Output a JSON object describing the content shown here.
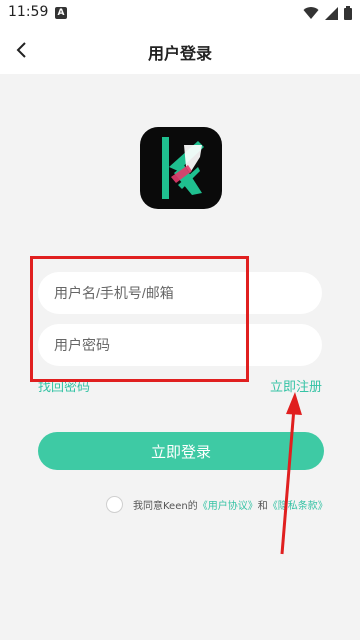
{
  "status_bar": {
    "time": "11:59",
    "badge": "A",
    "icons": [
      "wifi-icon",
      "signal-icon",
      "battery-icon"
    ]
  },
  "header": {
    "title": "用户登录",
    "back_icon": "chevron-left-icon"
  },
  "logo": {
    "name": "keen-app-logo"
  },
  "form": {
    "username_placeholder": "用户名/手机号/邮箱",
    "password_placeholder": "用户密码",
    "forgot_password": "找回密码",
    "register": "立即注册",
    "login_button": "立即登录"
  },
  "agreement": {
    "prefix": "我同意Keen的",
    "user_agreement": "《用户协议》",
    "and": "和",
    "privacy_policy": "《隐私条款》"
  },
  "colors": {
    "accent": "#3ecaa4",
    "link": "#36c3a5",
    "annotation": "#e01f1f",
    "background": "#f3f3f3"
  }
}
